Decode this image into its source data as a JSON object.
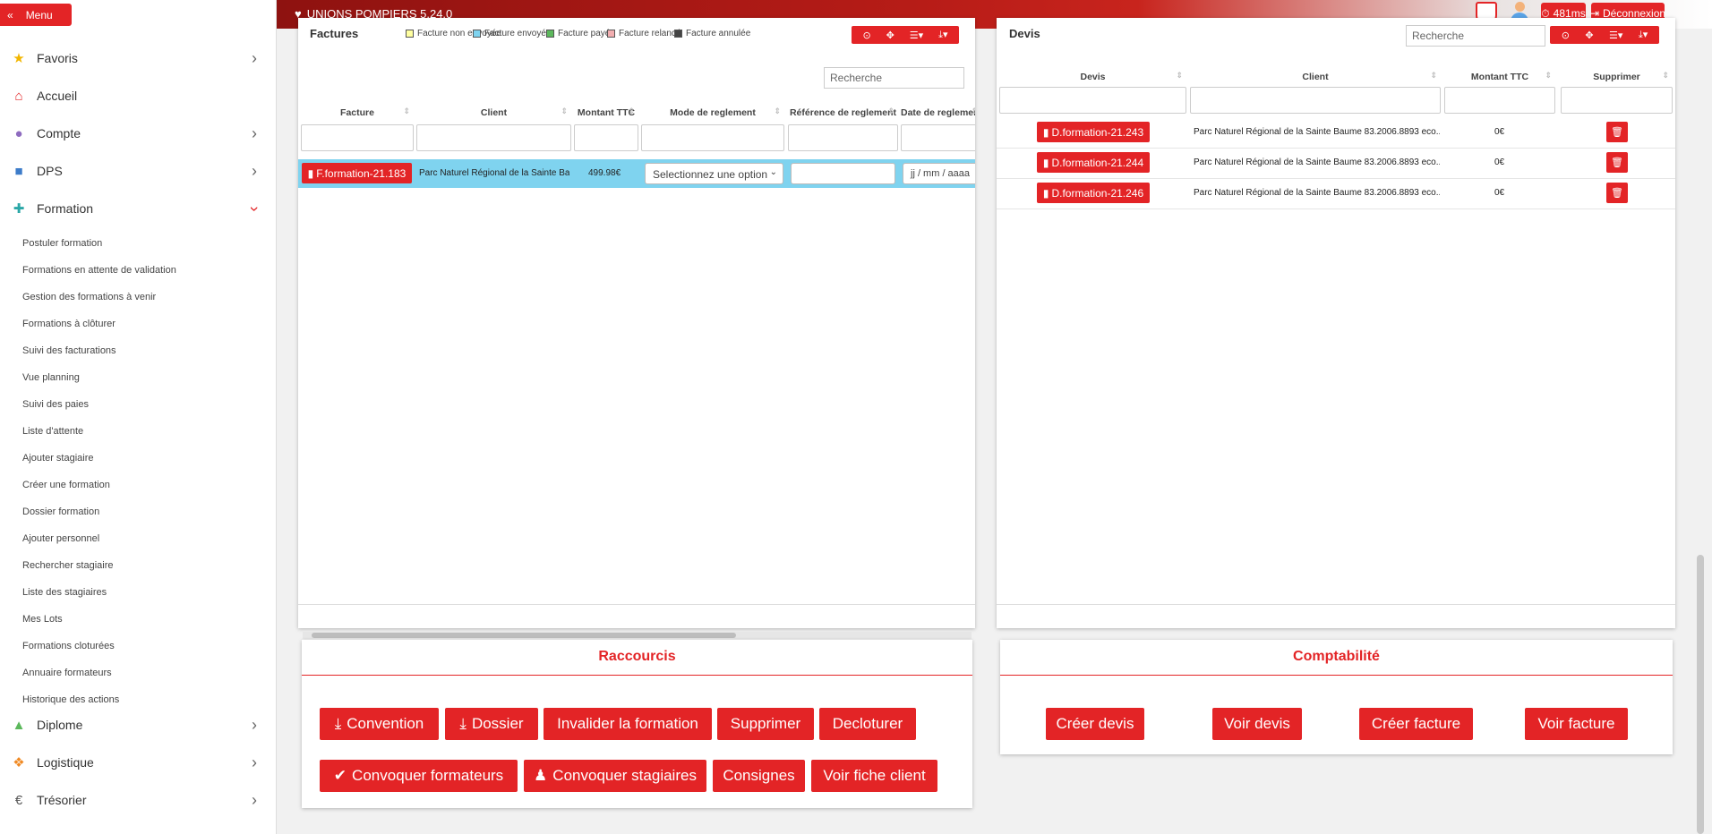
{
  "sidebar": {
    "menu_label": "Menu",
    "items": [
      {
        "label": "Favoris",
        "icon": "star-icon"
      },
      {
        "label": "Accueil",
        "icon": "home-icon"
      },
      {
        "label": "Compte",
        "icon": "user-icon"
      },
      {
        "label": "DPS",
        "icon": "ambulance-icon"
      },
      {
        "label": "Formation",
        "icon": "medkit-icon"
      },
      {
        "label": "Diplome",
        "icon": "graduation-cap-icon"
      },
      {
        "label": "Logistique",
        "icon": "cubes-icon"
      },
      {
        "label": "Trésorier",
        "icon": "euro-icon"
      }
    ],
    "formation_sub": [
      "Postuler formation",
      "Formations en attente de validation",
      "Gestion des formations à venir",
      "Formations à clôturer",
      "Suivi des facturations",
      "Vue planning",
      "Suivi des paies",
      "Liste d'attente",
      "Ajouter stagiaire",
      "Créer une formation",
      "Dossier formation",
      "Ajouter personnel",
      "Rechercher stagiaire",
      "Liste des stagiaires",
      "Mes Lots",
      "Formations cloturées",
      "Annuaire formateurs",
      "Historique des actions"
    ]
  },
  "topbar": {
    "title": "UNIONS POMPIERS 5.24.0",
    "timer": "481ms",
    "logout": "Déconnexion"
  },
  "factures": {
    "title": "Factures",
    "legend": [
      "Facture non envoyée",
      "Facture envoyée",
      "Facture payée",
      "Facture relancé",
      "Facture annulée"
    ],
    "legend_colors": [
      "#ffffa0",
      "#7fd3ef",
      "#5cb85c",
      "#f2aeb0",
      "#444444"
    ],
    "search_placeholder": "Recherche",
    "columns": [
      "Facture",
      "Client",
      "Montant TTC",
      "Mode de reglement",
      "Référence de reglement",
      "Date de reglement"
    ],
    "rows": [
      {
        "facture": "F.formation-21.183",
        "client": "Parc Naturel Régional de la Sainte Baume",
        "montant": "499.98€",
        "mode_placeholder": "Selectionnez une option",
        "date_placeholder": "jj / mm / aaaa"
      }
    ]
  },
  "devis": {
    "title": "Devis",
    "search_placeholder": "Recherche",
    "columns": [
      "Devis",
      "Client",
      "Montant TTC",
      "Supprimer"
    ],
    "rows": [
      {
        "devis": "D.formation-21.243",
        "client": "Parc Naturel Régional de la Sainte Baume 83.2006.8893 eco...",
        "montant": "0€"
      },
      {
        "devis": "D.formation-21.244",
        "client": "Parc Naturel Régional de la Sainte Baume 83.2006.8893 eco...",
        "montant": "0€"
      },
      {
        "devis": "D.formation-21.246",
        "client": "Parc Naturel Régional de la Sainte Baume 83.2006.8893 eco...",
        "montant": "0€"
      }
    ]
  },
  "raccourcis": {
    "title": "Raccourcis",
    "buttons": [
      "Convention",
      "Dossier",
      "Invalider la formation",
      "Supprimer",
      "Decloturer",
      "Convoquer formateurs",
      "Convoquer stagiaires",
      "Consignes",
      "Voir fiche client"
    ]
  },
  "comptabilite": {
    "title": "Comptabilité",
    "buttons": [
      "Créer devis",
      "Voir devis",
      "Créer facture",
      "Voir facture"
    ]
  },
  "colors": {
    "accent": "#e32426",
    "row_selected": "#7fd3ef"
  }
}
